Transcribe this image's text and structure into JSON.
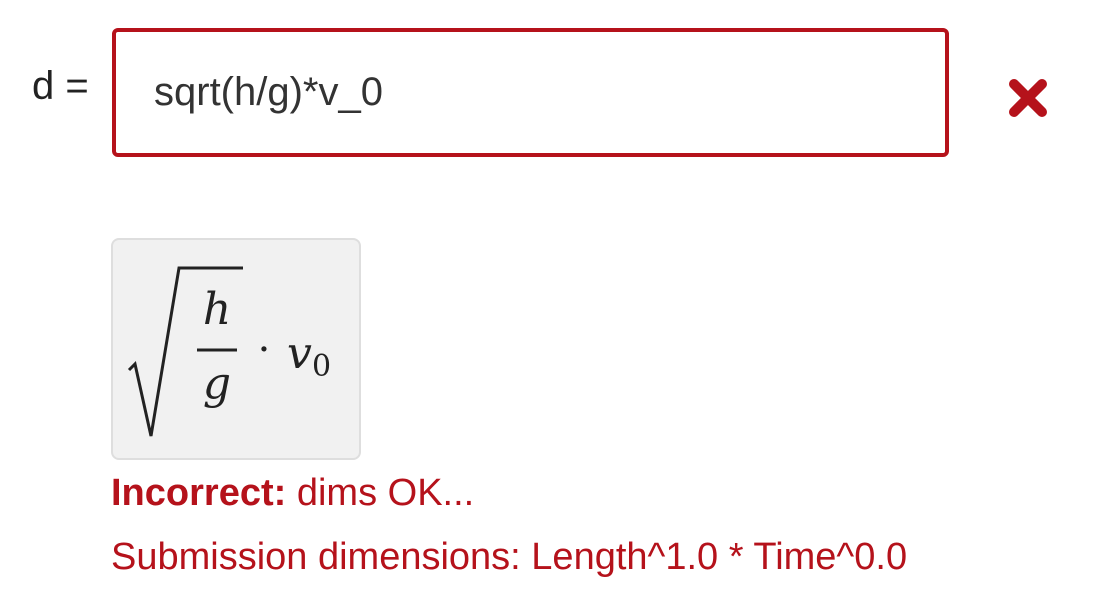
{
  "question": {
    "variable_label": "d ="
  },
  "input": {
    "value": "sqrt(h/g)*v_0",
    "status": "incorrect",
    "status_icon": "cross-icon",
    "error_color": "#b5121b"
  },
  "preview": {
    "numerator": "h",
    "denominator": "g",
    "operator": "·",
    "factor": "v",
    "factor_subscript": "0"
  },
  "feedback": {
    "label": "Incorrect:",
    "summary": "dims OK...",
    "details": "Submission dimensions: Length^1.0 * Time^0.0"
  }
}
